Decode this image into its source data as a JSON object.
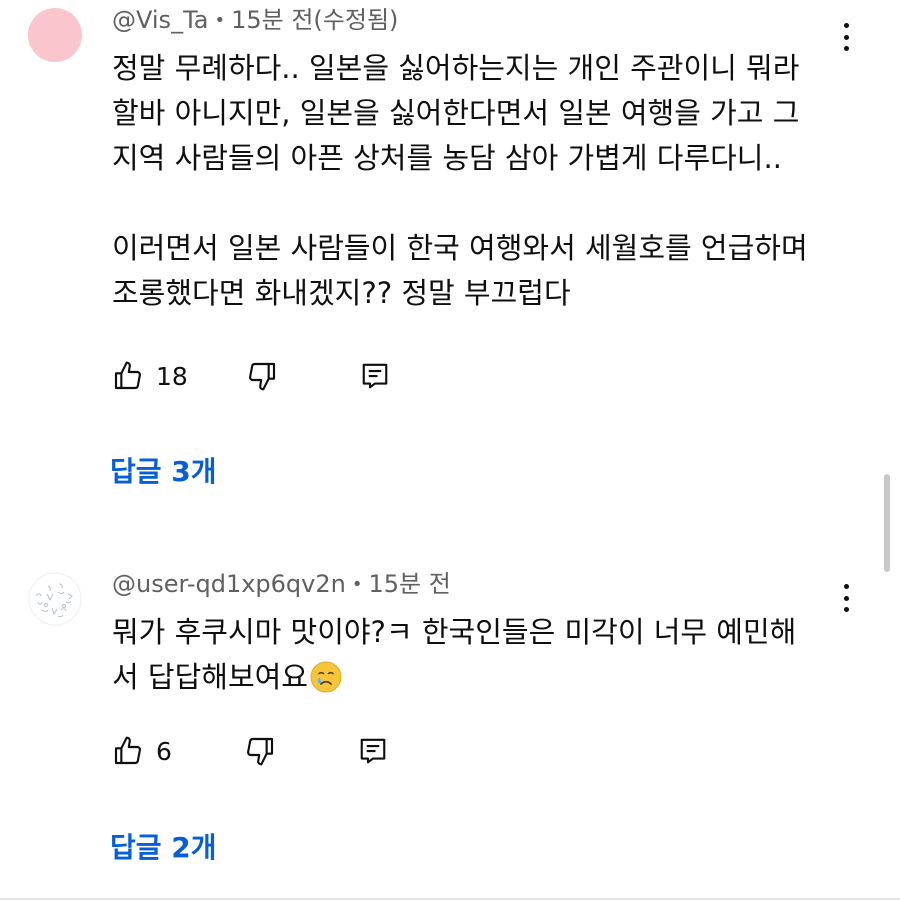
{
  "comments": [
    {
      "author": "@Vis_Ta",
      "separator": "•",
      "time": "15분 전(수정됨)",
      "avatar_color": "#fbc5cd",
      "lines": [
        "정말 무례하다.. 일본을 싫어하는지는 개인 주관이니 뭐라",
        "할바 아니지만, 일본을 싫어한다면서 일본 여행을 가고 그",
        "지역 사람들의 아픈 상처를 농담 삼아 가볍게 다루다니..",
        "",
        "이러면서 일본 사람들이 한국 여행와서 세월호를 언급하며",
        "조롱했다면 화내겠지?? 정말 부끄럽다"
      ],
      "likes": "18",
      "replies_label": "답글 3개"
    },
    {
      "author": "@user-qd1xp6qv2n",
      "separator": "•",
      "time": "15분 전",
      "avatar_style": "doodle",
      "lines": [
        "뭐가 후쿠시마 맛이야?ㅋ 한국인들은 미각이 너무 예민해",
        "서 답답해보여요"
      ],
      "emoji": "crying-face-emoji",
      "likes": "6",
      "replies_label": "답글 2개"
    }
  ],
  "icons": {
    "like": "thumbs-up-icon",
    "dislike": "thumbs-down-icon",
    "reply": "reply-comment-icon",
    "menu": "more-vertical-icon"
  },
  "colors": {
    "link_blue": "#065fd4",
    "meta_gray": "#606060",
    "text": "#0f0f0f"
  }
}
